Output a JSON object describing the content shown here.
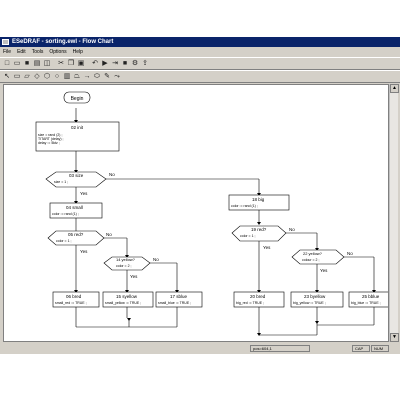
{
  "window": {
    "title": "ESeDRAF - sorting.ewl - Flow Chart"
  },
  "menu": [
    "File",
    "Edit",
    "Tools",
    "Options",
    "Help"
  ],
  "toolbar1": [
    "new-icon",
    "open-icon",
    "save-icon",
    "print-icon",
    "preview-icon",
    "cut-icon",
    "copy-icon",
    "paste-icon",
    "undo-icon",
    "run-icon",
    "step-icon",
    "stop-icon",
    "compile-icon",
    "export-icon"
  ],
  "toolbar2": [
    "pointer-icon",
    "process-icon",
    "input-icon",
    "decision-icon",
    "loop-icon",
    "connector-icon",
    "subroutine-icon",
    "output-icon",
    "arrow-icon",
    "end-icon",
    "comment-icon",
    "link-icon"
  ],
  "status": {
    "pos": "pos=604,1",
    "cap": "CAP",
    "num": "NUM"
  },
  "flowchart": {
    "begin": "Begin",
    "yes": "Yes",
    "no": "No",
    "n02": {
      "label": "02 init",
      "lines": [
        "size = rand (2) ;",
        "TITART (delay) ;",
        "delay := 5ktz ;"
      ]
    },
    "n03": {
      "label": "03 size",
      "line": "size = 1 ;"
    },
    "n04": {
      "label": "04 small",
      "line": "color := rand (1) ;"
    },
    "n05": {
      "label": "05 red?",
      "line": "color = 1 ;"
    },
    "n06": {
      "label": "06 bred",
      "line": "small_red := TRUE ;"
    },
    "n14": {
      "label": "14 yellow?",
      "line": "color = 2 ;"
    },
    "n15": {
      "label": "15 syellow",
      "line": "small_yellow := TRUE ;"
    },
    "n17": {
      "label": "17 sblue",
      "line": "small_blue := TRUE ;"
    },
    "n18": {
      "label": "18 big",
      "line": "color := rand (1) ;"
    },
    "n19": {
      "label": "19 red?",
      "line": "color = 1 ;"
    },
    "n20": {
      "label": "20 bred",
      "line": "big_red := TRUE ;"
    },
    "n22": {
      "label": "22 yellow?",
      "line": "colour = 2 ;"
    },
    "n23": {
      "label": "23 byellow",
      "line": "big_yellow := TRUE ;"
    },
    "n25": {
      "label": "25 bblue",
      "line": "big_blue := TRUE ;"
    }
  }
}
